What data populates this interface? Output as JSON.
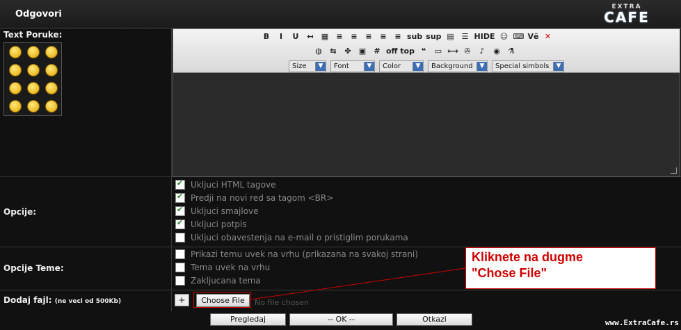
{
  "header": {
    "title": "Odgovori",
    "logo_top": "EXTRA",
    "logo_main": "CAFE"
  },
  "message": {
    "label": "Text Poruke:"
  },
  "toolbar": {
    "row1": [
      "B",
      "I",
      "U",
      "↤",
      "▦",
      "≡",
      "≡",
      "≡",
      "≡",
      "≡",
      "sub",
      "sup",
      "▤",
      "☰",
      "HIDE",
      "☺",
      "⌨",
      "Vё",
      "✕"
    ],
    "row2": [
      "◍",
      "⇆",
      "✤",
      "▣",
      "#",
      "off top",
      "❝",
      "▭",
      "⟷",
      "✇",
      "♪",
      "◉",
      "⚗"
    ],
    "selects": [
      {
        "label": "Size"
      },
      {
        "label": "Font"
      },
      {
        "label": "Color"
      },
      {
        "label": "Background"
      },
      {
        "label": "Special simbols"
      }
    ]
  },
  "options": {
    "label": "Opcije:",
    "items": [
      {
        "text": "Ukljuci HTML tagove",
        "checked": true
      },
      {
        "text": "Predji na novi red sa tagom <BR>",
        "checked": true
      },
      {
        "text": "Ukljuci smajlove",
        "checked": true
      },
      {
        "text": "Ukljuci potpis",
        "checked": true
      },
      {
        "text": "Ukljuci obavestenja na e-mail o pristiglim porukama",
        "checked": false
      }
    ]
  },
  "topic_options": {
    "label": "Opcije Teme:",
    "items": [
      {
        "text": "Prikazi temu uvek na vrhu (prikazana na svakoj strani)",
        "checked": false
      },
      {
        "text": "Tema uvek na vrhu",
        "checked": false
      },
      {
        "text": "Zakljucana tema",
        "checked": false
      }
    ]
  },
  "attach": {
    "label": "Dodaj fajl:",
    "note": "(ne veci od 500Kb)",
    "plus": "+",
    "choose": "Choose File",
    "nofile": "No file chosen"
  },
  "callout": {
    "line1": "Kliknete na dugme",
    "line2": "\"Chose File\""
  },
  "footer": {
    "preview": "Pregledaj",
    "ok": "-- OK --",
    "cancel": "Otkazi",
    "site": "www.ExtraCafe.rs"
  },
  "colors": {
    "accent": "#d00000",
    "background": "#111111"
  }
}
